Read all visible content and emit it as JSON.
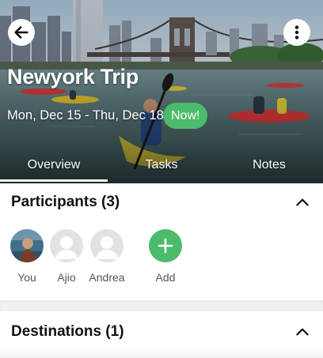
{
  "trip": {
    "title": "Newyork Trip",
    "dates": "Mon, Dec 15 - Thu, Dec 18",
    "badge": "Now!"
  },
  "header": {
    "back_icon": "arrow-left-icon",
    "more_icon": "more-vertical-icon"
  },
  "tabs": [
    {
      "label": "Overview",
      "active": true
    },
    {
      "label": "Tasks",
      "active": false
    },
    {
      "label": "Notes",
      "active": false
    }
  ],
  "participants": {
    "title": "Participants (3)",
    "people": [
      {
        "name": "You",
        "avatar": "photo"
      },
      {
        "name": "Ajio",
        "avatar": "placeholder"
      },
      {
        "name": "Andrea",
        "avatar": "placeholder"
      }
    ],
    "add_label": "Add"
  },
  "destinations": {
    "title": "Destinations (1)"
  },
  "colors": {
    "accent_green": "#4cbb6c",
    "title_text": "#111111",
    "muted_text": "#555555"
  }
}
